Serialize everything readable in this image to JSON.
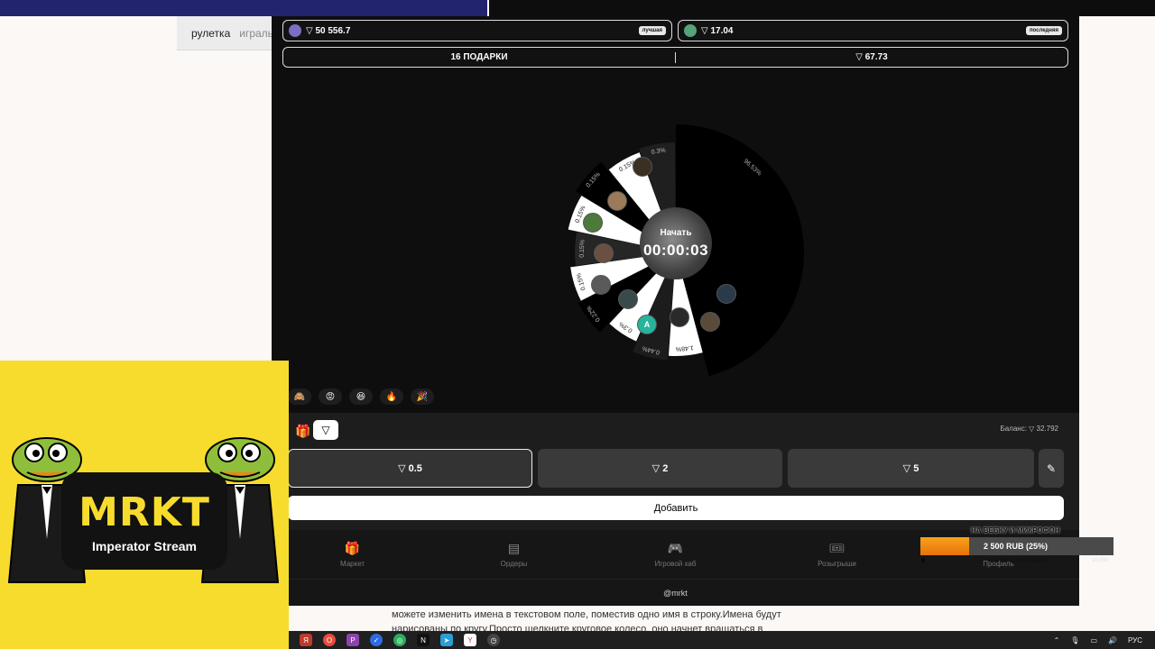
{
  "background": {
    "tab_active": "рулетка",
    "tab_inactive": "игралы",
    "paragraph": "можете изменить имена в текстовом поле, поместив одно имя в строку.Имена будут нарисованы по кругу.Просто щелкните круговое колесо, оно начнет вращаться в"
  },
  "stats": {
    "best": {
      "value": "▽ 50 556.7",
      "badge": "лучшая"
    },
    "last": {
      "value": "▽ 17.04",
      "badge": "последняя"
    }
  },
  "summary": {
    "gifts": "16 ПОДАРКИ",
    "total": "▽ 67.73"
  },
  "wheel": {
    "start_label": "Начать",
    "timer": "00:00:03",
    "avatar_letter": "A",
    "segments": [
      {
        "label": "96.53%",
        "share": 0.9653
      },
      {
        "label": "1.48%",
        "share": 0.0148
      },
      {
        "label": "0.44%",
        "share": 0.0044
      },
      {
        "label": "0.3%",
        "share": 0.003
      },
      {
        "label": "0.22%",
        "share": 0.0022
      },
      {
        "label": "0.15%",
        "share": 0.0015
      },
      {
        "label": "0.15%",
        "share": 0.0015
      },
      {
        "label": "0.15%",
        "share": 0.0015
      },
      {
        "label": "0.15%",
        "share": 0.0015
      },
      {
        "label": "0.15%",
        "share": 0.0015
      },
      {
        "label": "0.3%",
        "share": 0.003
      }
    ]
  },
  "reactions": [
    "🙈",
    "😡",
    "😆",
    "🔥",
    "🎉"
  ],
  "bet": {
    "balance": "Баланс: ▽ 32.792",
    "amounts": [
      "▽ 0.5",
      "▽ 2",
      "▽ 5"
    ],
    "add_label": "Добавить",
    "edit_icon": "✎"
  },
  "nav": [
    {
      "label": "Маркет",
      "icon": "gift-icon"
    },
    {
      "label": "Ордеры",
      "icon": "clipboard-icon"
    },
    {
      "label": "Игровой хаб",
      "icon": "gamepad-icon"
    },
    {
      "label": "Розыгрыши",
      "icon": "ticket-icon"
    },
    {
      "label": "Профиль",
      "icon": "user-icon"
    }
  ],
  "footer": "@mrkt",
  "logo": {
    "main": "MRKT",
    "sub": "Imperator Stream"
  },
  "goal": {
    "title": "НА ВЕБКУ И МИКРОФОН",
    "amount": "2 500 RUB (25%)",
    "progress": 0.25,
    "min": "0",
    "status": "СБОР ЗАВЕРШЁН",
    "max": "10 000"
  },
  "tray": {
    "lang": "РУС"
  },
  "colors": {
    "app_bg": "#0e0e0e",
    "panel": "#1d1d1d",
    "logo_yellow": "#f7dc2e",
    "goal_orange": "#ee8512"
  }
}
